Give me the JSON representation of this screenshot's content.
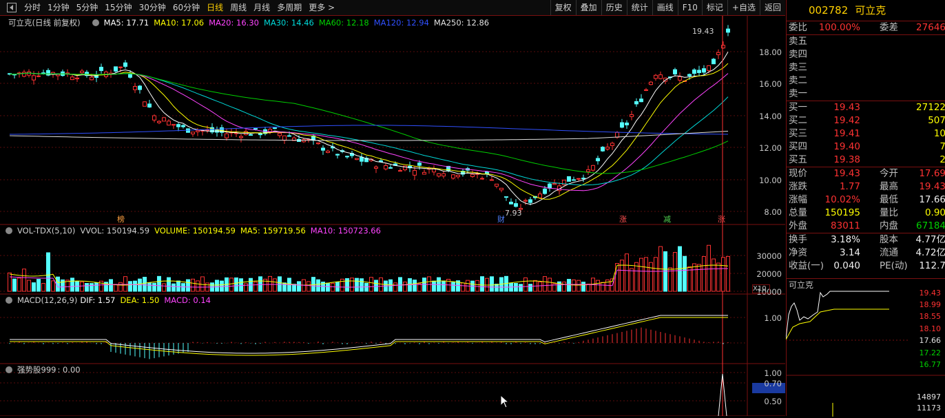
{
  "toolbar": {
    "periods": [
      "分时",
      "1分钟",
      "5分钟",
      "15分钟",
      "30分钟",
      "60分钟",
      "日线",
      "周线",
      "月线",
      "多周期",
      "更多 >"
    ],
    "active_period": "日线",
    "right_buttons": [
      "复权",
      "叠加",
      "历史",
      "统计",
      "画线",
      "F10",
      "标记",
      "+自选",
      "返回"
    ]
  },
  "main_pane": {
    "header": {
      "stock": "可立克(日线 前复权)",
      "ma5": "MA5: 17.71",
      "ma10": "MA10: 17.06",
      "ma20": "MA20: 16.30",
      "ma30": "MA30: 14.46",
      "ma60": "MA60: 12.18",
      "ma120": "MA120: 12.94",
      "ma250": "MA250: 12.86"
    },
    "y_ticks": [
      "18.00",
      "16.00",
      "14.00",
      "12.00",
      "10.00",
      "8.00"
    ],
    "high_label": "19.43",
    "low_label": "7.93",
    "markers": [
      "榜",
      "财",
      "涨",
      "减",
      "涨"
    ]
  },
  "vol_pane": {
    "header": {
      "name": "VOL-TDX(5,10)",
      "vvol": "VVOL: 150194.59",
      "volume": "VOLUME: 150194.59",
      "ma5": "MA5: 159719.56",
      "ma10": "MA10: 150723.66"
    },
    "y_ticks": [
      "30000",
      "20000",
      "10000"
    ],
    "unit": "X10"
  },
  "macd_pane": {
    "header": {
      "name": "MACD(12,26,9)",
      "dif": "DIF: 1.57",
      "dea": "DEA: 1.50",
      "macd": "MACD: 0.14"
    },
    "y_ticks": [
      "1.00"
    ]
  },
  "strong_pane": {
    "header": {
      "name": "强势股999",
      "value": ": 0.00"
    },
    "y_ticks": [
      "1.00",
      "0.70",
      "0.50"
    ]
  },
  "quote": {
    "code": "002782",
    "name": "可立克",
    "weibi_label": "委比",
    "weibi": "100.00%",
    "weicha_label": "委差",
    "weicha": "27646",
    "sells": [
      {
        "label": "卖五"
      },
      {
        "label": "卖四"
      },
      {
        "label": "卖三"
      },
      {
        "label": "卖二"
      },
      {
        "label": "卖一"
      }
    ],
    "buys": [
      {
        "label": "买一",
        "price": "19.43",
        "vol": "27122"
      },
      {
        "label": "买二",
        "price": "19.42",
        "vol": "507"
      },
      {
        "label": "买三",
        "price": "19.41",
        "vol": "10"
      },
      {
        "label": "买四",
        "price": "19.40",
        "vol": "7"
      },
      {
        "label": "买五",
        "price": "19.38",
        "vol": "2"
      }
    ],
    "stats": [
      {
        "l1": "现价",
        "v1": "19.43",
        "l2": "今开",
        "v2": "17.69"
      },
      {
        "l1": "涨跌",
        "v1": "1.77",
        "l2": "最高",
        "v2": "19.43"
      },
      {
        "l1": "涨幅",
        "v1": "10.02%",
        "l2": "最低",
        "v2": "17.66"
      },
      {
        "l1": "总量",
        "v1": "150195",
        "l2": "量比",
        "v2": "0.90"
      },
      {
        "l1": "外盘",
        "v1": "83011",
        "l2": "内盘",
        "v2": "67184"
      }
    ],
    "stats2": [
      {
        "l1": "换手",
        "v1": "3.18%",
        "l2": "股本",
        "v2": "4.77亿"
      },
      {
        "l1": "净资",
        "v1": "3.14",
        "l2": "流通",
        "v2": "4.72亿"
      },
      {
        "l1": "收益(一)",
        "v1": "0.040",
        "l2": "PE(动)",
        "v2": "112.7"
      }
    ]
  },
  "mini_chart": {
    "title": "可立克",
    "price_ticks": [
      "19.43",
      "18.99",
      "18.55",
      "18.10",
      "17.66",
      "17.22",
      "16.77"
    ],
    "vol_ticks": [
      "14897",
      "11173"
    ]
  },
  "colors": {
    "up": "#ff3232",
    "down": "#54ffff",
    "ma5": "#ffffff",
    "ma10": "#ffff00",
    "ma20": "#ff44ff",
    "ma30": "#00d8d8",
    "ma60": "#00d000",
    "ma120": "#3050ff",
    "ma250": "#e0e0e0"
  }
}
